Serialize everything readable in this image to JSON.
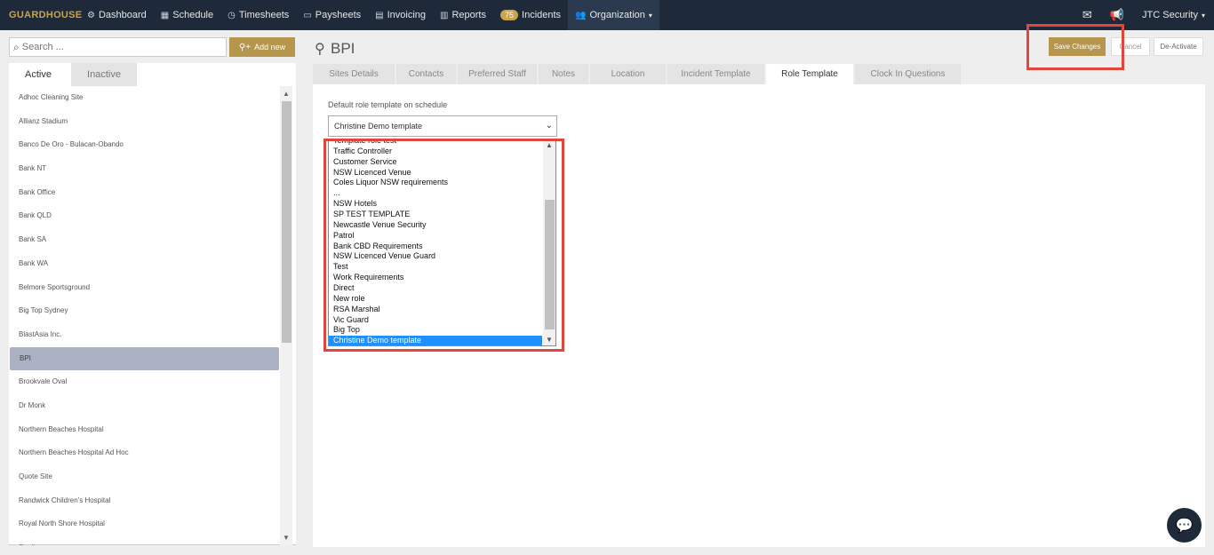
{
  "brand": "GUARDHOUSE",
  "nav": [
    {
      "icon": "dashboard-icon",
      "glyph": "⚙",
      "label": "Dashboard"
    },
    {
      "icon": "calendar-icon",
      "glyph": "▦",
      "label": "Schedule"
    },
    {
      "icon": "clock-icon",
      "glyph": "◷",
      "label": "Timesheets"
    },
    {
      "icon": "money-icon",
      "glyph": "▭",
      "label": "Paysheets"
    },
    {
      "icon": "invoice-icon",
      "glyph": "▤",
      "label": "Invoicing"
    },
    {
      "icon": "reports-icon",
      "glyph": "▥",
      "label": "Reports"
    },
    {
      "icon": "incidents-badge",
      "badge": "75",
      "label": "Incidents"
    },
    {
      "icon": "users-icon",
      "glyph": "👥",
      "label": "Organization"
    }
  ],
  "nav_right": {
    "user": "JTC Security"
  },
  "search": {
    "placeholder": "Search ..."
  },
  "add_new_label": "Add new",
  "left_tabs": {
    "active": "Active",
    "inactive": "Inactive"
  },
  "sites": [
    "Adhoc Cleaning Site",
    "Allianz Stadium",
    "Banco De Oro - Bulacan-Obando",
    "Bank NT",
    "Bank Office",
    "Bank QLD",
    "Bank SA",
    "Bank WA",
    "Belmore Sportsground",
    "Big Top Sydney",
    "BlastAsia Inc.",
    "BPI",
    "Brookvale Oval",
    "Dr Monk",
    "Northern Beaches Hospital",
    "Northern Beaches Hospital Ad Hoc",
    "Quote Site",
    "Randwick Children's Hospital",
    "Royal North Shore Hospital",
    "Stadium"
  ],
  "selected_site": "BPI",
  "page_title": "BPI",
  "buttons": {
    "save": "Save Changes",
    "cancel": "Cancel",
    "deactivate": "De-Activate"
  },
  "tabs": [
    {
      "label": "Sites Details",
      "w": 92
    },
    {
      "label": "Contacts",
      "w": 67
    },
    {
      "label": "Preferred Staff",
      "w": 89
    },
    {
      "label": "Notes",
      "w": 56
    },
    {
      "label": "Location",
      "w": 85
    },
    {
      "label": "Incident Template",
      "w": 109
    },
    {
      "label": "Role Template",
      "w": 98
    },
    {
      "label": "Clock In Questions",
      "w": 119
    }
  ],
  "active_tab": "Role Template",
  "field_label": "Default role template on schedule",
  "select_value": "Christine Demo template",
  "options": [
    "Template role test",
    "Traffic Controller",
    "Customer Service",
    "NSW Licenced Venue",
    "Coles Liquor NSW requirements",
    "...",
    "NSW Hotels",
    "SP TEST TEMPLATE",
    "Newcastle Venue Security",
    "Patrol",
    "Bank CBD Requirements",
    "NSW Licenced Venue Guard",
    "Test",
    "Work Requirements",
    "Direct",
    "New role",
    "RSA Marshal",
    "Vic Guard",
    "Big Top",
    "Christine Demo template"
  ]
}
